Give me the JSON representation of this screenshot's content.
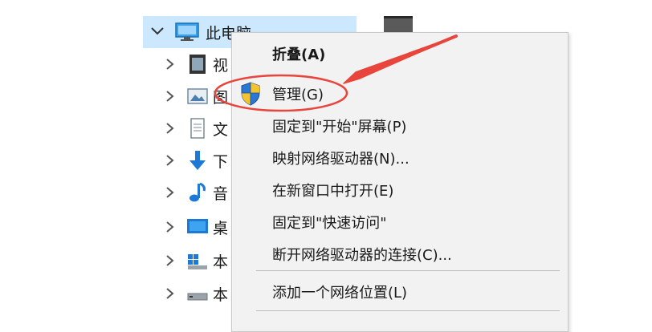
{
  "tree": {
    "root_label": "此电脑",
    "items": [
      {
        "label": "视",
        "icon": "video-folder-icon"
      },
      {
        "label": "图",
        "icon": "pictures-folder-icon"
      },
      {
        "label": "文",
        "icon": "documents-folder-icon"
      },
      {
        "label": "下",
        "icon": "downloads-folder-icon"
      },
      {
        "label": "音",
        "icon": "music-folder-icon"
      },
      {
        "label": "桌",
        "icon": "desktop-folder-icon"
      },
      {
        "label": "本",
        "icon": "local-disk-icon"
      },
      {
        "label": "本",
        "icon": "drive-icon"
      }
    ]
  },
  "context_menu": {
    "items": [
      {
        "label": "折叠(A)",
        "bold": true
      },
      {
        "label": "管理(G)",
        "icon": "uac-shield-icon",
        "highlighted": true
      },
      {
        "label": "固定到\"开始\"屏幕(P)"
      },
      {
        "label": "映射网络驱动器(N)..."
      },
      {
        "label": "在新窗口中打开(E)"
      },
      {
        "label": "固定到\"快速访问\""
      },
      {
        "label": "断开网络驱动器的连接(C)..."
      },
      {
        "label": "添加一个网络位置(L)"
      }
    ]
  },
  "colors": {
    "selection": "#cce8ff",
    "menu_bg": "#f2f2f2",
    "annotation_red": "#e8453c"
  }
}
